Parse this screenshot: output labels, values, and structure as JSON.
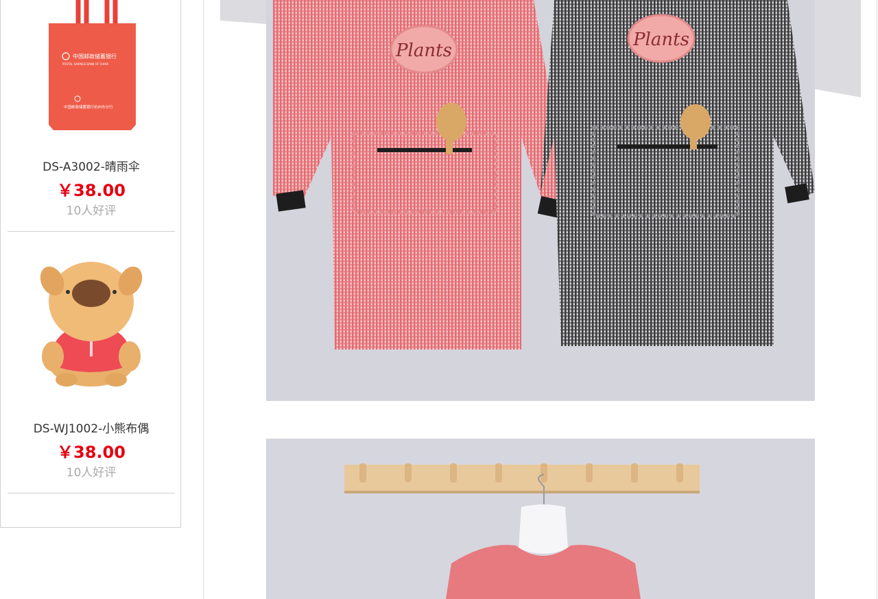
{
  "sidebar": {
    "products": [
      {
        "name": "DS-A3002-晴雨伞",
        "price": "￥38.00",
        "reviews": "10人好评",
        "bag_text_1": "中国邮政储蓄银行",
        "bag_text_2": "POSTAL SAVINGS BANK OF CHINA",
        "bag_text_3": "中国邮政储蓄银行杭州市分行"
      },
      {
        "name": "DS-WJ1002-小熊布偶",
        "price": "￥38.00",
        "reviews": "10人好评"
      }
    ]
  },
  "main": {
    "photo1": {
      "patch_left": "Plants",
      "patch_right": "Plants"
    }
  },
  "colors": {
    "price": "#e60012",
    "apron_red": "#e05a5e",
    "apron_gray": "#6e6e72",
    "wall": "#d4d4dc"
  }
}
